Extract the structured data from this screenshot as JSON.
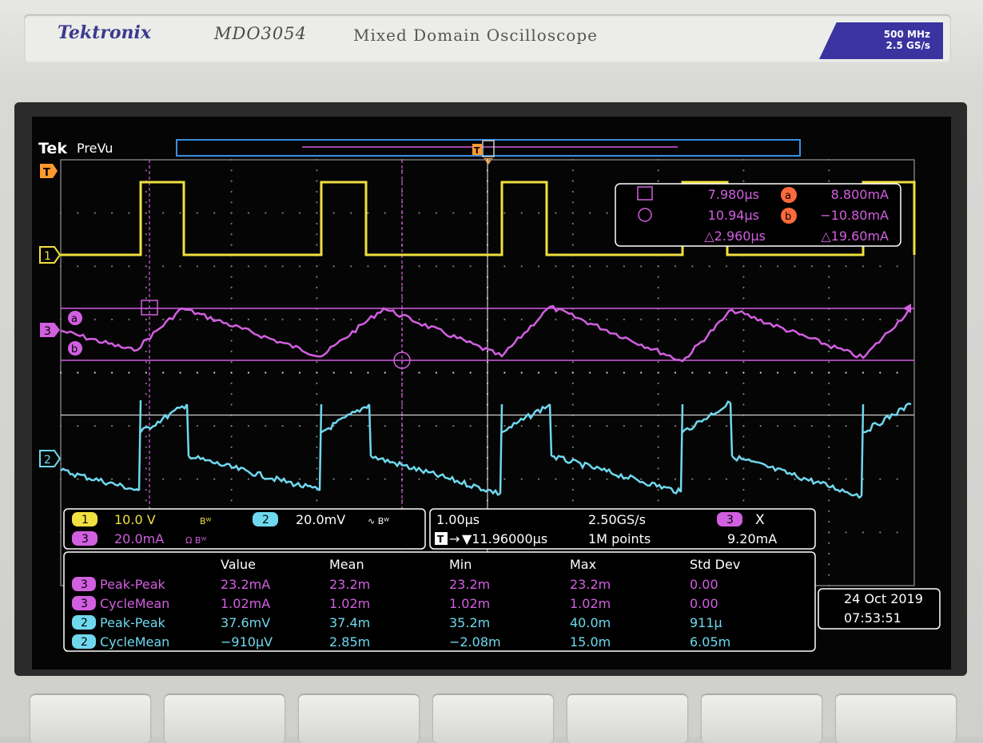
{
  "bezel": {
    "brand": "Tektronix",
    "model": "MDO3054",
    "description": "Mixed Domain Oscilloscope",
    "badge_bandwidth": "500 MHz",
    "badge_sample_rate": "2.5 GS/s"
  },
  "screen": {
    "logo": "Tek",
    "mode": "PreVu",
    "trigger_marker": "T",
    "channel_markers": {
      "ch1": "1",
      "ch3": "3",
      "ch2": "2"
    },
    "cursor_labels": {
      "a": "a",
      "b": "b"
    }
  },
  "cursor_readout": {
    "time1": "7.980µs",
    "time2": "10.94µs",
    "delta_time": "△2.960µs",
    "a_label": "a",
    "a_value": "8.800mA",
    "b_label": "b",
    "b_value": "−10.80mA",
    "delta_value": "△19.60mA"
  },
  "channels": [
    {
      "badge": "1",
      "scale": "10.0 V",
      "flag": "Bᵂ",
      "color": "#f0e040"
    },
    {
      "badge": "2",
      "scale": "20.0mV",
      "flag": "∿ Bᵂ",
      "color": "#6fd8ee"
    },
    {
      "badge": "3",
      "scale": "20.0mA",
      "flag": "Ω Bᵂ",
      "color": "#d25fe0"
    }
  ],
  "timebase": {
    "scale": "1.00µs",
    "sample_rate": "2.50GS/s",
    "trigger_position": "▼11.96000µs",
    "record_length": "1M points",
    "trigger_channel": "3",
    "trigger_slope": "X",
    "trigger_level": "9.20mA"
  },
  "measurements": {
    "headers": [
      "Value",
      "Mean",
      "Min",
      "Max",
      "Std Dev"
    ],
    "rows": [
      {
        "ch": "3",
        "name": "Peak-Peak",
        "value": "23.2mA",
        "mean": "23.2m",
        "min": "23.2m",
        "max": "23.2m",
        "std": "0.00"
      },
      {
        "ch": "3",
        "name": "CycleMean",
        "value": "1.02mA",
        "mean": "1.02m",
        "min": "1.02m",
        "max": "1.02m",
        "std": "0.00"
      },
      {
        "ch": "2",
        "name": "Peak-Peak",
        "value": "37.6mV",
        "mean": "37.4m",
        "min": "35.2m",
        "max": "40.0m",
        "std": "911µ"
      },
      {
        "ch": "2",
        "name": "CycleMean",
        "value": "−910µV",
        "mean": "2.85m",
        "min": "−2.08m",
        "max": "15.0m",
        "std": "6.05m"
      }
    ]
  },
  "datetime": {
    "date": "24 Oct  2019",
    "time": "07:53:51"
  },
  "colors": {
    "ch1": "#f0e040",
    "ch2": "#6fd8ee",
    "ch3": "#d25fe0",
    "trigger": "#ff9a2e",
    "overview": "#3a8de0",
    "panel_bg": "#000000",
    "badge_bezel": "#3a33a0"
  }
}
